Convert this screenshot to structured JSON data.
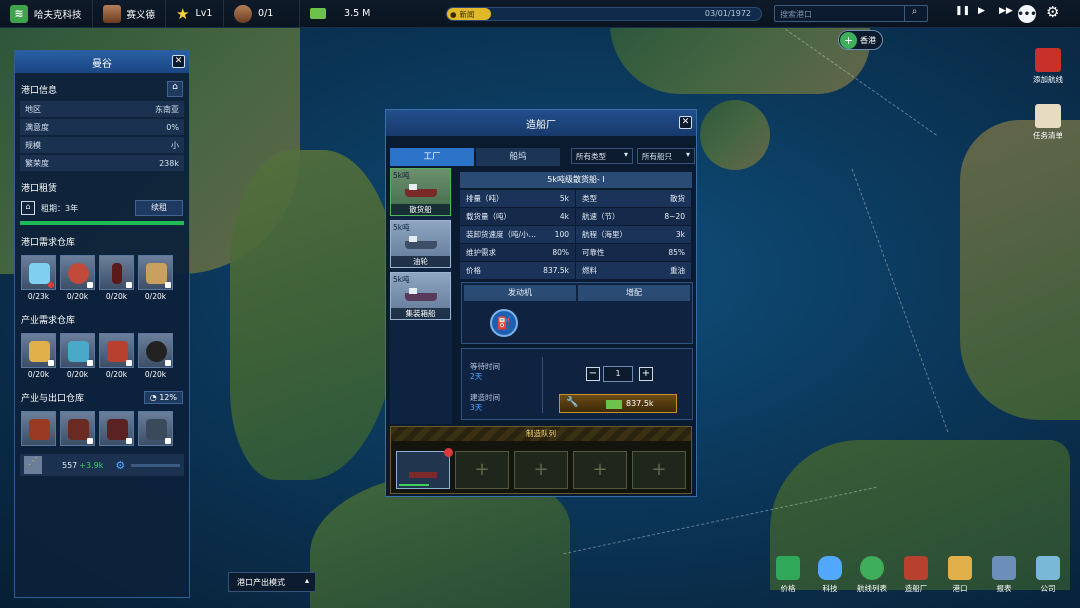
{
  "topbar": {
    "company": "哈夫克科技",
    "ceo": "赛义德",
    "level": "Lv1",
    "ships": "0/1",
    "money": "3.5 M",
    "news_label": "新闻",
    "date": "03/01/1972",
    "search_placeholder": "搜索港口"
  },
  "map": {
    "hk_label": "香港"
  },
  "port_panel": {
    "title": "曼谷",
    "info_title": "港口信息",
    "info": [
      {
        "k": "地区",
        "v": "东南亚"
      },
      {
        "k": "满意度",
        "v": "0%"
      },
      {
        "k": "规模",
        "v": "小"
      },
      {
        "k": "繁荣度",
        "v": "238k"
      }
    ],
    "lease_title": "港口租赁",
    "lease_term": "租期：3年",
    "renew": "续租",
    "demand_title": "港口需求仓库",
    "demand": [
      "0/23k",
      "0/20k",
      "0/20k",
      "0/20k"
    ],
    "industry_title": "产业需求仓库",
    "industry": [
      "0/20k",
      "0/20k",
      "0/20k",
      "0/20k"
    ],
    "export_title": "产业与出口仓库",
    "export_pct": "12%",
    "grain": "557",
    "grain_delta": "+3.9k"
  },
  "shipyard": {
    "title": "造船厂",
    "tab_factory": "工厂",
    "tab_ship": "船坞",
    "filter_type": "所有类型",
    "filter_ship": "所有船只",
    "ships": [
      {
        "cap": "5k吨",
        "name": "散货船"
      },
      {
        "cap": "5k吨",
        "name": "油轮"
      },
      {
        "cap": "5k吨",
        "name": "集装箱船"
      }
    ],
    "selected": "5k吨级散货船- I",
    "stats": [
      {
        "k": "排量（吨）",
        "v": "5k"
      },
      {
        "k": "类型",
        "v": "散货"
      },
      {
        "k": "载货量（吨）",
        "v": "4k"
      },
      {
        "k": "航速（节）",
        "v": "8~20"
      },
      {
        "k": "装卸货速度（吨/小…",
        "v": "100"
      },
      {
        "k": "航程（海里）",
        "v": "3k"
      },
      {
        "k": "维护需求",
        "v": "80%"
      },
      {
        "k": "可靠性",
        "v": "85%"
      },
      {
        "k": "价格",
        "v": "837.5k"
      },
      {
        "k": "燃料",
        "v": "重油"
      }
    ],
    "sub_engine": "发动机",
    "sub_equip": "增配",
    "wait_label": "等待时间",
    "wait_val": "2天",
    "build_label": "建造时间",
    "build_val": "3天",
    "qty": "1",
    "price": "837.5k",
    "queue_title": "制造队列"
  },
  "right_side": {
    "add_route": "添加航线",
    "task": "任务清单"
  },
  "bottom": [
    "价格",
    "科技",
    "航线列表",
    "造船厂",
    "港口",
    "报表",
    "公司"
  ],
  "mode": "港口产出模式",
  "colors": {
    "accent": "#2c74c9",
    "green": "#1dbb55",
    "gold": "#e0b92a"
  }
}
